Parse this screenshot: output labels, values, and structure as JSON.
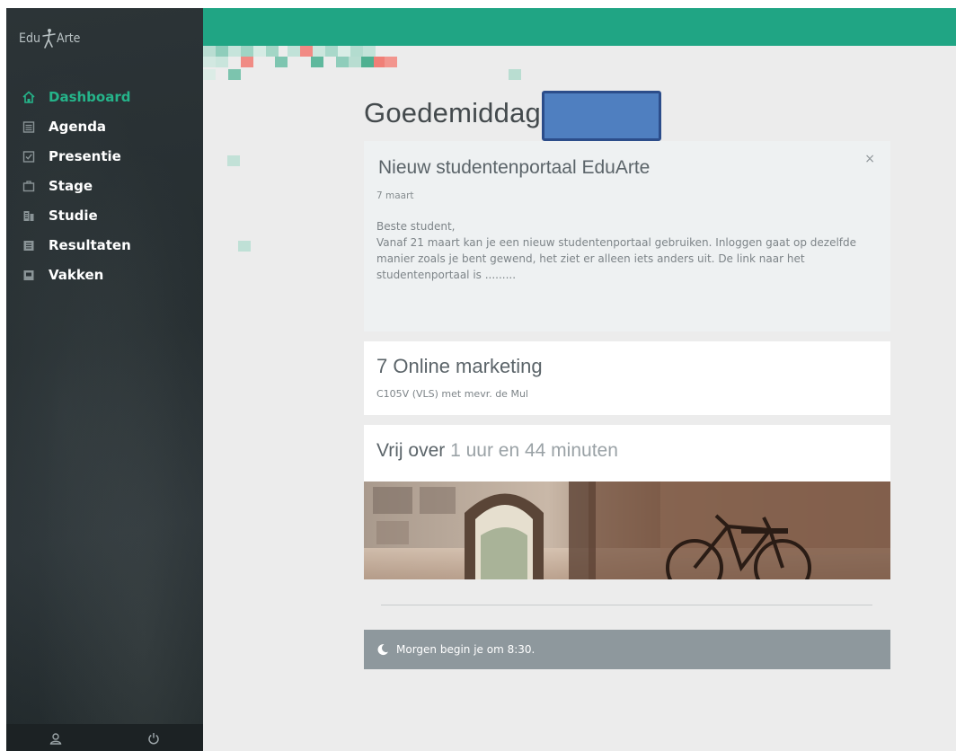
{
  "sidebar": {
    "logo_left": "Edu",
    "logo_right": "Arte",
    "nav": [
      {
        "label": "Dashboard",
        "icon": "home-icon",
        "active": true
      },
      {
        "label": "Agenda",
        "icon": "calendar-icon"
      },
      {
        "label": "Presentie",
        "icon": "attendance-icon"
      },
      {
        "label": "Stage",
        "icon": "briefcase-icon"
      },
      {
        "label": "Studie",
        "icon": "study-icon"
      },
      {
        "label": "Resultaten",
        "icon": "results-icon"
      },
      {
        "label": "Vakken",
        "icon": "subjects-icon"
      }
    ],
    "footer": {
      "left_icon": "user-icon",
      "right_icon": "power-icon"
    }
  },
  "colors": {
    "brand_green": "#20a584",
    "active_nav": "#25b48a",
    "redaction": "#4f7fc0"
  },
  "main": {
    "greeting": "Goedemiddag",
    "news": {
      "title": "Nieuw studentenportaal EduArte",
      "close": "×",
      "date": "7 maart",
      "salutation": "Beste student,",
      "body": "Vanaf 21 maart kan je een nieuw studentenportaal gebruiken. Inloggen gaat op dezelfde manier zoals je bent gewend, het ziet er alleen iets anders uit. De link naar het studentenportaal is ........."
    },
    "lesson": {
      "title": "7 Online marketing",
      "subtitle": "C105V (VLS) met mevr. de Mul"
    },
    "free": {
      "prefix": "Vrij over",
      "duration": "1 uur en 44 minuten"
    },
    "tomorrow": {
      "icon": "moon-icon",
      "text": "Morgen begin je om 8:30."
    }
  }
}
